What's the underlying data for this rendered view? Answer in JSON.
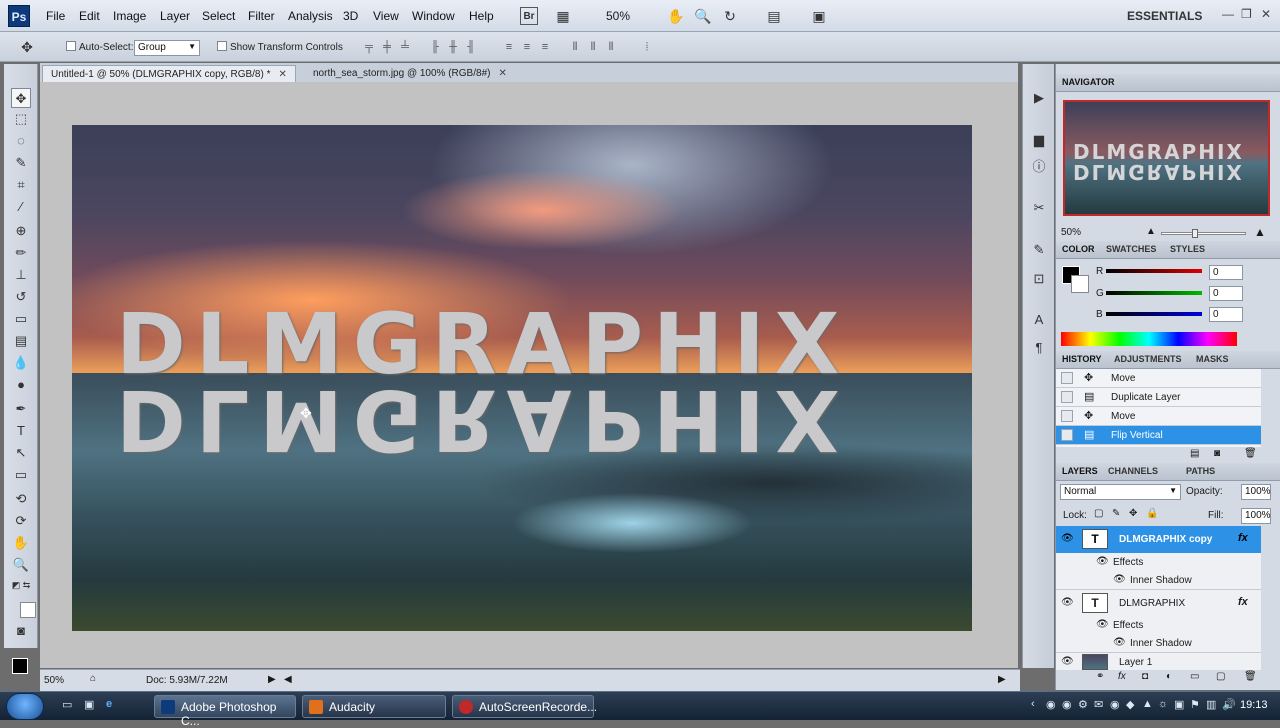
{
  "menubar": {
    "logo": "Ps",
    "items": [
      "File",
      "Edit",
      "Image",
      "Layer",
      "Select",
      "Filter",
      "Analysis",
      "3D",
      "View",
      "Window",
      "Help"
    ],
    "bridge_label": "Br",
    "zoom": "50%",
    "workspace": "ESSENTIALS"
  },
  "options": {
    "auto_select_label": "Auto-Select:",
    "auto_select_value": "Group",
    "show_transform_label": "Show Transform Controls"
  },
  "tabs": [
    {
      "label": "Untitled-1 @ 50% (DLMGRAPHIX copy, RGB/8) *"
    },
    {
      "label": "north_sea_storm.jpg @ 100% (RGB/8#)"
    }
  ],
  "canvas": {
    "text": "DLMGRAPHIX"
  },
  "status": {
    "zoom": "50%",
    "doc": "Doc: 5.93M/7.22M"
  },
  "navigator": {
    "title": "NAVIGATOR",
    "thumb_text": "DLMGRAPHIX",
    "zoom": "50%"
  },
  "color_panel": {
    "tabs": [
      "COLOR",
      "SWATCHES",
      "STYLES"
    ],
    "r_label": "R",
    "r_value": "0",
    "g_label": "G",
    "g_value": "0",
    "b_label": "B",
    "b_value": "0"
  },
  "history_panel": {
    "tabs": [
      "HISTORY",
      "ADJUSTMENTS",
      "MASKS"
    ],
    "items": [
      "Move",
      "Duplicate Layer",
      "Move",
      "Flip Vertical"
    ]
  },
  "layers_panel": {
    "tabs": [
      "LAYERS",
      "CHANNELS",
      "PATHS"
    ],
    "blend_mode": "Normal",
    "opacity_label": "Opacity:",
    "opacity_value": "100%",
    "lock_label": "Lock:",
    "fill_label": "Fill:",
    "fill_value": "100%",
    "layers": [
      {
        "name": "DLMGRAPHIX copy",
        "thumb": "T",
        "fx": "fx"
      },
      {
        "name": "Effects"
      },
      {
        "name": "Inner Shadow"
      },
      {
        "name": "DLMGRAPHIX",
        "thumb": "T",
        "fx": "fx"
      },
      {
        "name": "Effects"
      },
      {
        "name": "Inner Shadow"
      },
      {
        "name": "Layer 1"
      }
    ]
  },
  "taskbar": {
    "items": [
      "Adobe Photoshop C...",
      "Audacity",
      "AutoScreenRecorde..."
    ],
    "time": "19:13"
  }
}
